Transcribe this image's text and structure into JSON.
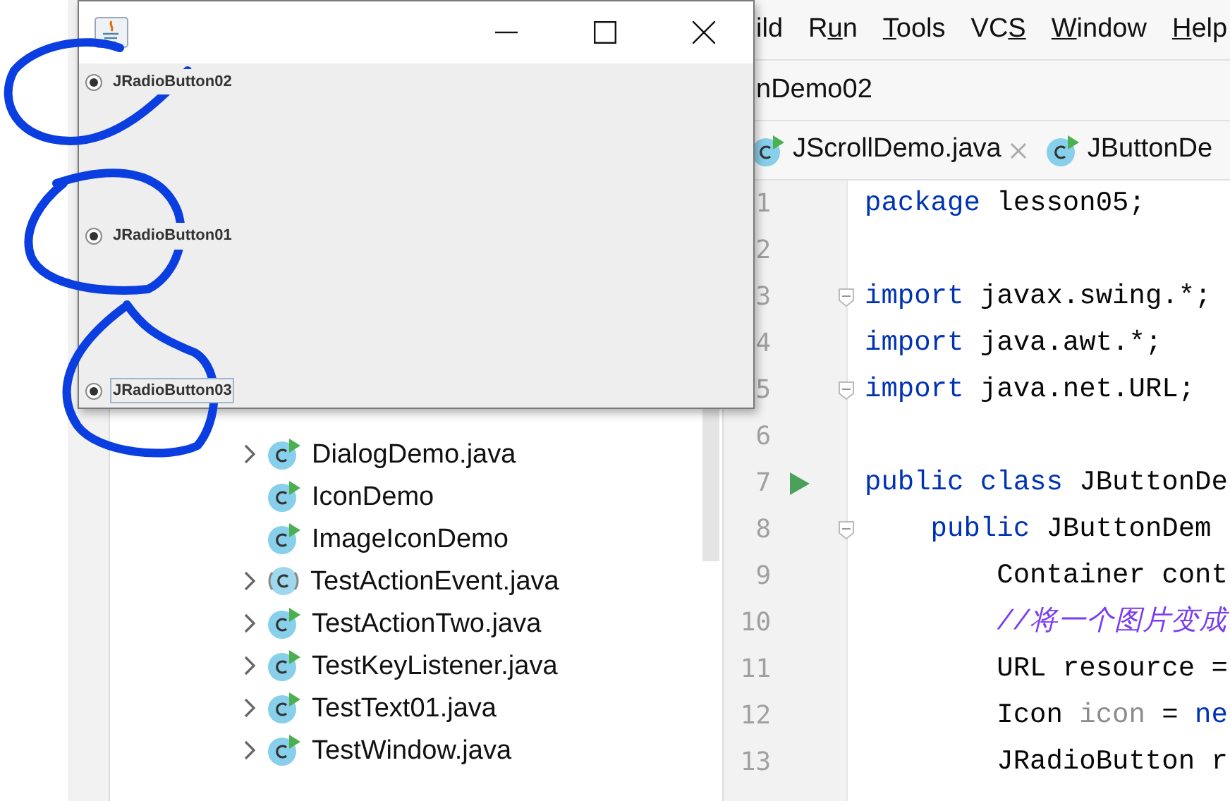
{
  "menu": [
    {
      "before": "ild"
    },
    {
      "before": "R",
      "key": "u",
      "after": "n"
    },
    {
      "key": "T",
      "after": "ools"
    },
    {
      "before": "VC",
      "key": "S"
    },
    {
      "key": "W",
      "after": "indow"
    },
    {
      "key": "H",
      "after": "elp"
    }
  ],
  "breadcrumb": "nDemo02",
  "tabs": [
    {
      "label": "JScrollDemo.java",
      "closable": true
    },
    {
      "label": "JButtonDe",
      "closable": false
    }
  ],
  "tree": [
    {
      "label": "DialogDemo.java",
      "kind": "class",
      "expandable": true
    },
    {
      "label": "IconDemo",
      "kind": "class",
      "expandable": false
    },
    {
      "label": "ImageIconDemo",
      "kind": "class",
      "expandable": false
    },
    {
      "label": "TestActionEvent.java",
      "kind": "abstract",
      "expandable": true
    },
    {
      "label": "TestActionTwo.java",
      "kind": "class",
      "expandable": true
    },
    {
      "label": "TestKeyListener.java",
      "kind": "class",
      "expandable": true
    },
    {
      "label": "TestText01.java",
      "kind": "class",
      "expandable": true
    },
    {
      "label": "TestWindow.java",
      "kind": "class",
      "expandable": true
    }
  ],
  "code": [
    {
      "number": "1",
      "kind": "plain",
      "tokens": [
        {
          "text": "package",
          "kind": "keyword"
        },
        {
          "text": " lesson05;",
          "kind": "plain"
        }
      ]
    },
    {
      "number": "2",
      "kind": "plain"
    },
    {
      "number": "3",
      "kind": "fold",
      "tokens": [
        {
          "text": "import",
          "kind": "keyword"
        },
        {
          "text": " javax.swing.*;",
          "kind": "plain"
        }
      ]
    },
    {
      "number": "4",
      "kind": "plain",
      "tokens": [
        {
          "text": "import",
          "kind": "keyword"
        },
        {
          "text": " java.awt.*;",
          "kind": "plain"
        }
      ]
    },
    {
      "number": "5",
      "kind": "fold",
      "tokens": [
        {
          "text": "import",
          "kind": "keyword"
        },
        {
          "text": " java.net.URL;",
          "kind": "plain"
        }
      ]
    },
    {
      "number": "6",
      "kind": "plain"
    },
    {
      "number": "7",
      "kind": "run",
      "tokens": [
        {
          "text": "public class",
          "kind": "keyword"
        },
        {
          "text": " JButtonDe",
          "kind": "plain"
        }
      ]
    },
    {
      "number": "8",
      "kind": "fold",
      "tokens": [
        {
          "text": "    public",
          "kind": "keyword"
        },
        {
          "text": " JButtonDem",
          "kind": "plain"
        }
      ]
    },
    {
      "number": "9",
      "kind": "plain",
      "tokens": [
        {
          "text": "        Container cont",
          "kind": "plain"
        }
      ]
    },
    {
      "number": "10",
      "kind": "plain",
      "tokens": [
        {
          "text": "        //将一个图片变成",
          "kind": "comment"
        }
      ]
    },
    {
      "number": "11",
      "kind": "plain",
      "tokens": [
        {
          "text": "        URL resource =",
          "kind": "plain"
        }
      ]
    },
    {
      "number": "12",
      "kind": "plain",
      "tokens": [
        {
          "text": "        Icon ",
          "kind": "plain"
        },
        {
          "text": "icon",
          "kind": "unused"
        },
        {
          "text": " = ",
          "kind": "plain"
        },
        {
          "text": "ne",
          "kind": "keyword"
        }
      ]
    },
    {
      "number": "13",
      "kind": "plain",
      "tokens": [
        {
          "text": "        JRadioButton r",
          "kind": "plain"
        }
      ]
    }
  ],
  "dialog": {
    "buttons": [
      {
        "kind": "minimize"
      },
      {
        "kind": "maximize"
      },
      {
        "kind": "close"
      }
    ],
    "radios": [
      {
        "label": "JRadioButton02",
        "selected": true,
        "focused": false
      },
      {
        "label": "JRadioButton01",
        "selected": true,
        "focused": false
      },
      {
        "label": "JRadioButton03",
        "selected": true,
        "focused": true
      }
    ]
  }
}
